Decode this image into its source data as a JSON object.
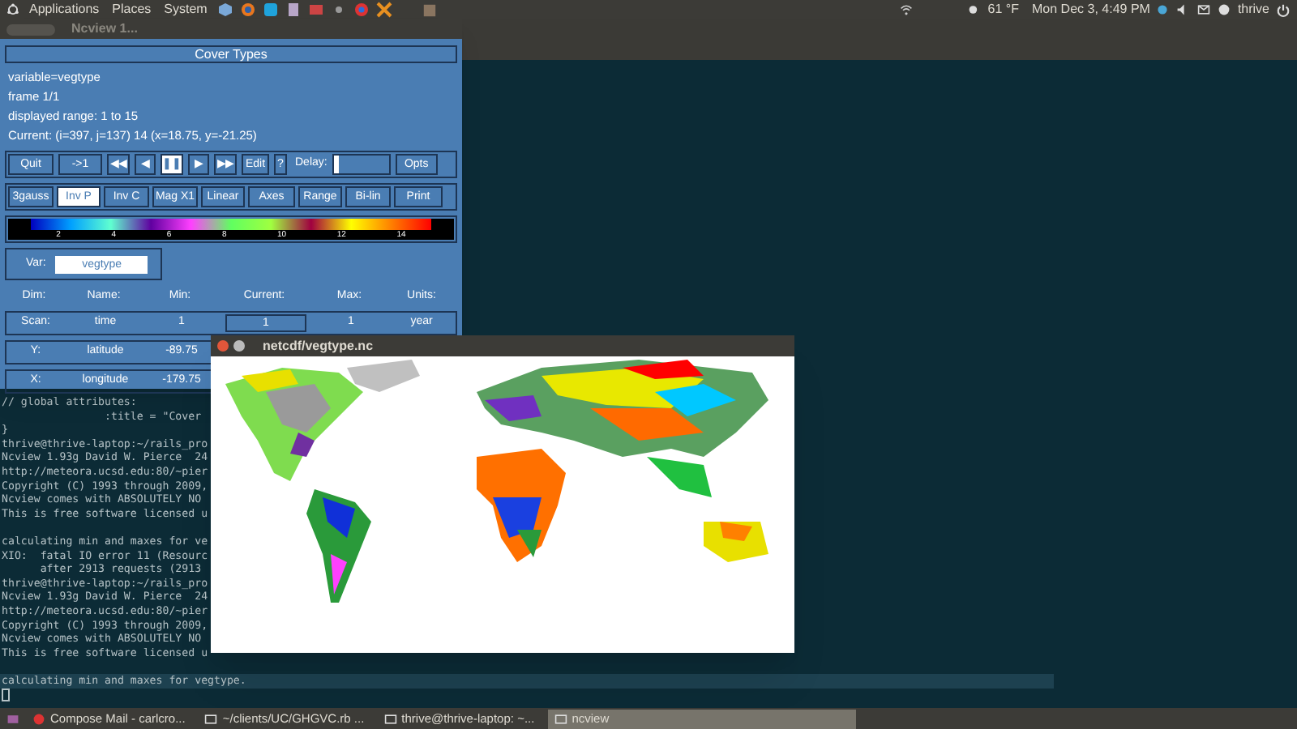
{
  "top_panel": {
    "menus": [
      "Applications",
      "Places",
      "System"
    ],
    "temperature": "61 °F",
    "clock": "Mon Dec  3,  4:49 PM",
    "user": "thrive"
  },
  "terminal": {
    "blocks": [
      [
        {
          "text": "// global attributes:"
        },
        {
          "text": "                :title = \"Cover"
        },
        {
          "text": "}"
        },
        {
          "text": "thrive@thrive-laptop:~/rails_pro"
        },
        {
          "text": "Ncview 1.93g David W. Pierce  24"
        },
        {
          "text": "http://meteora.ucsd.edu:80/~pier"
        },
        {
          "text": "Copyright (C) 1993 through 2009,"
        },
        {
          "text": "Ncview comes with ABSOLUTELY NO "
        },
        {
          "text": "This is free software licensed u"
        }
      ],
      [
        {
          "text": "calculating min and maxes for ve"
        },
        {
          "text": "XIO:  fatal IO error 11 (Resourc"
        },
        {
          "text": "      after 2913 requests (2913 "
        },
        {
          "text": "thrive@thrive-laptop:~/rails_pro"
        },
        {
          "text": "Ncview 1.93g David W. Pierce  24"
        },
        {
          "text": "http://meteora.ucsd.edu:80/~pier"
        },
        {
          "text": "Copyright (C) 1993 through 2009,"
        },
        {
          "text": "Ncview comes with ABSOLUTELY NO "
        },
        {
          "text": "This is free software licensed u"
        }
      ]
    ],
    "current_line": "calculating min and maxes for vegtype."
  },
  "ncview": {
    "title": "Ncview 1...",
    "header": "Cover Types",
    "info": [
      "variable=vegtype",
      "frame 1/1",
      "displayed range: 1 to 15",
      "Current: (i=397, j=137) 14 (x=18.75, y=-21.25)"
    ],
    "controls": [
      {
        "label": "Quit",
        "selected": false
      },
      {
        "label": "->1",
        "selected": false
      },
      {
        "label": "◀◀",
        "selected": false
      },
      {
        "label": "◀",
        "selected": false
      },
      {
        "label": "❚❚",
        "selected": true
      },
      {
        "label": "▶",
        "selected": false
      },
      {
        "label": "▶▶",
        "selected": false
      },
      {
        "label": "Edit",
        "selected": false
      },
      {
        "label": "?",
        "selected": false
      }
    ],
    "delay": {
      "label": "Delay:",
      "level": 0.05
    },
    "opts": "Opts",
    "options": [
      {
        "label": "3gauss",
        "selected": false
      },
      {
        "label": "Inv P",
        "selected": true
      },
      {
        "label": "Inv C",
        "selected": false
      },
      {
        "label": "Mag X1",
        "selected": false
      },
      {
        "label": "Linear",
        "selected": false
      },
      {
        "label": "Axes",
        "selected": false
      },
      {
        "label": "Range",
        "selected": false
      },
      {
        "label": "Bi-lin",
        "selected": false
      },
      {
        "label": "Print",
        "selected": false
      }
    ],
    "colorbar_ticks": [
      "2",
      "4",
      "6",
      "8",
      "10",
      "12",
      "14"
    ],
    "var": {
      "label": "Var:",
      "value": "vegtype"
    },
    "dims": {
      "columns": [
        "Dim:",
        "Name:",
        "Min:",
        "Current:",
        "Max:",
        "Units:"
      ],
      "rows": [
        [
          "Scan:",
          "time",
          "1",
          "1",
          "1",
          "year"
        ],
        [
          "Y:",
          "latitude",
          "-89.75"
        ],
        [
          "X:",
          "longitude",
          "-179.75"
        ]
      ]
    }
  },
  "map_window": {
    "title": "netcdf/vegtype.nc"
  },
  "taskbar": [
    {
      "label": "Compose Mail - carlcro...",
      "selected": false
    },
    {
      "label": "~/clients/UC/GHGVC.rb ...",
      "selected": false
    },
    {
      "label": "thrive@thrive-laptop: ~...",
      "selected": false
    },
    {
      "label": "ncview",
      "selected": true
    }
  ]
}
